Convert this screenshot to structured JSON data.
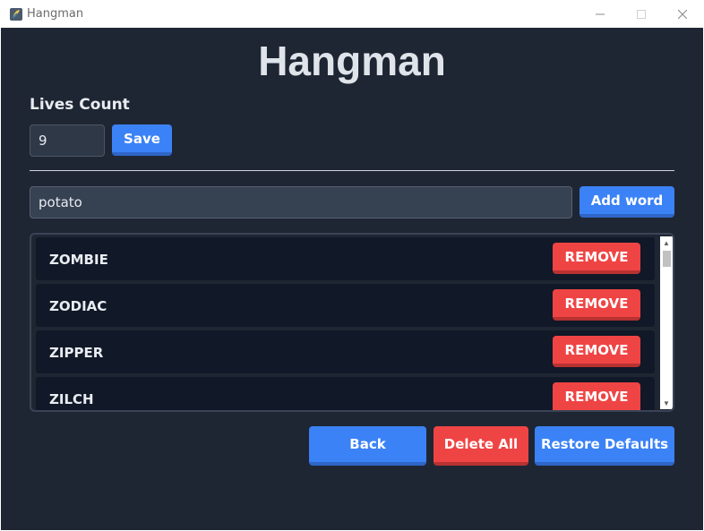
{
  "window": {
    "title": "Hangman"
  },
  "app": {
    "title": "Hangman"
  },
  "lives": {
    "label": "Lives Count",
    "value": "9",
    "save_label": "Save"
  },
  "word_entry": {
    "value": "potato",
    "add_label": "Add word"
  },
  "words": [
    {
      "label": "ZOMBIE",
      "remove_label": "REMOVE"
    },
    {
      "label": "ZODIAC",
      "remove_label": "REMOVE"
    },
    {
      "label": "ZIPPER",
      "remove_label": "REMOVE"
    },
    {
      "label": "ZILCH",
      "remove_label": "REMOVE"
    }
  ],
  "actions": {
    "back_label": "Back",
    "delete_all_label": "Delete All",
    "restore_label": "Restore Defaults"
  },
  "colors": {
    "background": "#1f2633",
    "row": "#111827",
    "primary": "#3b82f6",
    "danger": "#ef4444",
    "text": "#e9ecf1"
  },
  "icons": {
    "app": "python-feather-icon",
    "minimize": "minimize-icon",
    "maximize": "maximize-icon",
    "close": "close-icon",
    "scroll_up": "scroll-up-arrow-icon",
    "scroll_down": "scroll-down-arrow-icon"
  }
}
